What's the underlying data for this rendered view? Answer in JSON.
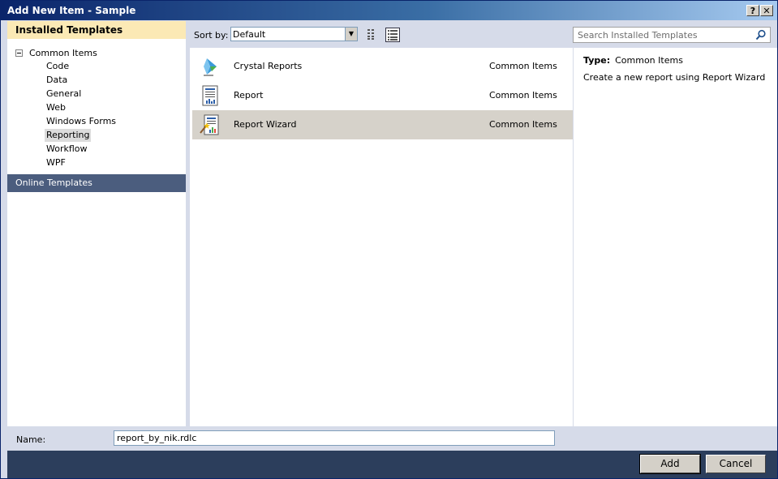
{
  "window": {
    "title": "Add New Item - Sample",
    "help_label": "?",
    "close_label": "✕"
  },
  "left_panel": {
    "installed_header": "Installed Templates",
    "root": "Common Items",
    "items": [
      "Code",
      "Data",
      "General",
      "Web",
      "Windows Forms",
      "Reporting",
      "Workflow",
      "WPF"
    ],
    "selected_item": "Reporting",
    "online_templates": "Online Templates"
  },
  "toolbar": {
    "sort_label": "Sort by:",
    "sort_value": "Default",
    "search_placeholder": "Search Installed Templates"
  },
  "templates": [
    {
      "name": "Crystal Reports",
      "category": "Common Items",
      "icon": "crystal-reports-icon"
    },
    {
      "name": "Report",
      "category": "Common Items",
      "icon": "report-icon"
    },
    {
      "name": "Report Wizard",
      "category": "Common Items",
      "icon": "report-wizard-icon",
      "selected": true
    }
  ],
  "detail": {
    "type_label": "Type:",
    "type_value": "Common Items",
    "description": "Create a new report using Report Wizard"
  },
  "form": {
    "name_label": "Name:",
    "name_value": "report_by_nik.rdlc"
  },
  "buttons": {
    "add": "Add",
    "cancel": "Cancel"
  },
  "colors": {
    "title_bar": "#0a246a",
    "installed_header_bg": "#fbe9b5",
    "online_templates_bg": "#4b5d7e",
    "footer_bg": "#2c3e5c",
    "selected_row_bg": "#d6d2ca"
  }
}
